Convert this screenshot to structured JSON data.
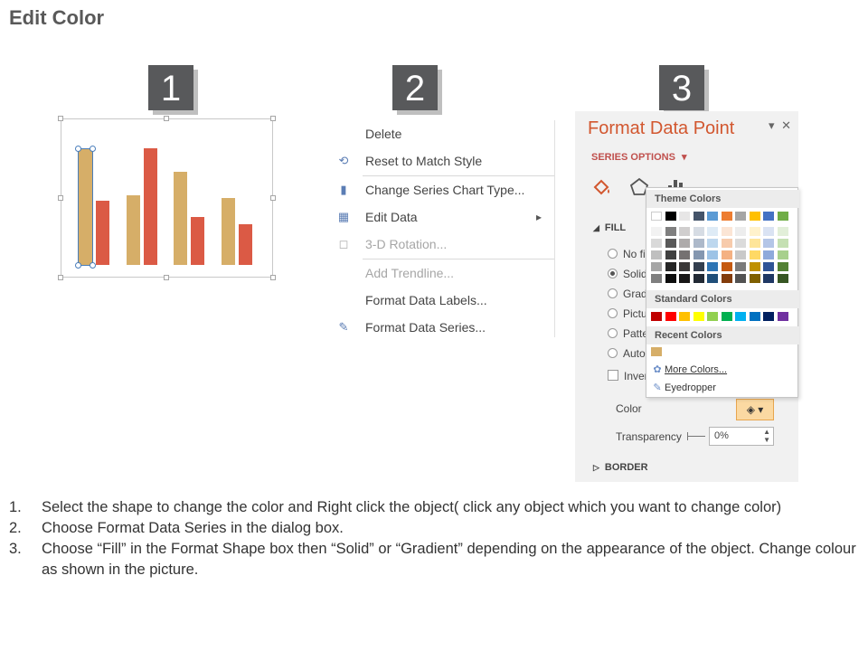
{
  "page": {
    "title": "Edit Color"
  },
  "steps": [
    "1",
    "2",
    "3"
  ],
  "colors": {
    "bar_gold": "#d6ae68",
    "bar_red": "#db5a45",
    "accent_orange": "#d2572f"
  },
  "chart_data": {
    "type": "bar",
    "categories": [
      "",
      "",
      "",
      ""
    ],
    "series": [
      {
        "values": [
          97,
          58,
          78,
          56
        ]
      },
      {
        "values": [
          54,
          98,
          40,
          34
        ]
      }
    ],
    "ylim": [
      0,
      100
    ],
    "grid": false
  },
  "context_menu": {
    "items": [
      {
        "label": "Delete",
        "icon": "",
        "disabled": false
      },
      {
        "label": "Reset to Match Style",
        "icon": "reset-style-icon",
        "disabled": false
      },
      {
        "label": "Change Series Chart Type...",
        "icon": "bar-chart-icon",
        "disabled": false
      },
      {
        "label": "Edit Data",
        "icon": "edit-data-icon",
        "disabled": false,
        "has_submenu": true
      },
      {
        "label": "3-D Rotation...",
        "icon": "cube-icon",
        "disabled": true
      },
      {
        "label": "Add Trendline...",
        "icon": "",
        "disabled": true
      },
      {
        "label": "Format Data Labels...",
        "icon": "",
        "disabled": false
      },
      {
        "label": "Format Data Series...",
        "icon": "format-series-icon",
        "disabled": false
      }
    ]
  },
  "format_pane": {
    "title": "Format Data Point",
    "series_options": "SERIES OPTIONS",
    "fill_heading": "FILL",
    "fill_options": [
      {
        "label": "No fi",
        "selected": false
      },
      {
        "label": "Solid",
        "selected": true
      },
      {
        "label": "Grad",
        "selected": false
      },
      {
        "label": "Pictu",
        "selected": false
      },
      {
        "label": "Patte",
        "selected": false
      },
      {
        "label": "Auto",
        "selected": false
      }
    ],
    "invert_label": "Inver",
    "color_label": "Color",
    "transparency_label": "Transparency",
    "transparency_value": "0%",
    "border_heading": "BORDER"
  },
  "palette": {
    "theme_colors_label": "Theme Colors",
    "standard_colors_label": "Standard Colors",
    "recent_colors_label": "Recent Colors",
    "more_colors_label": "More Colors...",
    "eyedropper_label": "Eyedropper",
    "theme_top_row": [
      "#ffffff",
      "#000000",
      "#e7e6e6",
      "#44546a",
      "#5b9bd5",
      "#ed7d31",
      "#a5a5a5",
      "#ffc000",
      "#4472c4",
      "#70ad47"
    ],
    "theme_shades": [
      [
        "#f2f2f2",
        "#d9d9d9",
        "#bfbfbf",
        "#a6a6a6",
        "#7f7f7f"
      ],
      [
        "#7f7f7f",
        "#595959",
        "#404040",
        "#262626",
        "#0d0d0d"
      ],
      [
        "#d0cece",
        "#aeabab",
        "#757171",
        "#3a3838",
        "#171616"
      ],
      [
        "#d6dce4",
        "#adb9ca",
        "#8497b0",
        "#333f4f",
        "#222a35"
      ],
      [
        "#deebf6",
        "#bdd7ee",
        "#9dc3e6",
        "#2e75b5",
        "#1f4e79"
      ],
      [
        "#fbe5d5",
        "#f7cbac",
        "#f4b183",
        "#c55a11",
        "#833c0b"
      ],
      [
        "#ededed",
        "#dbdbdb",
        "#c9c9c9",
        "#7b7b7b",
        "#525252"
      ],
      [
        "#fff2cc",
        "#fee599",
        "#ffd965",
        "#bf9000",
        "#7f6000"
      ],
      [
        "#dae3f3",
        "#b4c6e7",
        "#8eaadb",
        "#2f5496",
        "#1f3864"
      ],
      [
        "#e2efd9",
        "#c5e0b3",
        "#a8d08d",
        "#538135",
        "#375623"
      ]
    ],
    "standard": [
      "#c00000",
      "#ff0000",
      "#ffc000",
      "#ffff00",
      "#92d050",
      "#00b050",
      "#00b0f0",
      "#0070c0",
      "#002060",
      "#7030a0"
    ],
    "recent": [
      "#d6ae68"
    ]
  },
  "instructions": [
    {
      "num": "1.",
      "text": "Select the shape to change the color and Right click the object( click any object which you want to change color)"
    },
    {
      "num": "2.",
      "text": "Choose Format Data Series in the dialog box."
    },
    {
      "num": "3.",
      "text": "Choose “Fill” in the Format Shape box then “Solid” or “Gradient” depending on the appearance of the object. Change colour as shown in the picture."
    }
  ]
}
